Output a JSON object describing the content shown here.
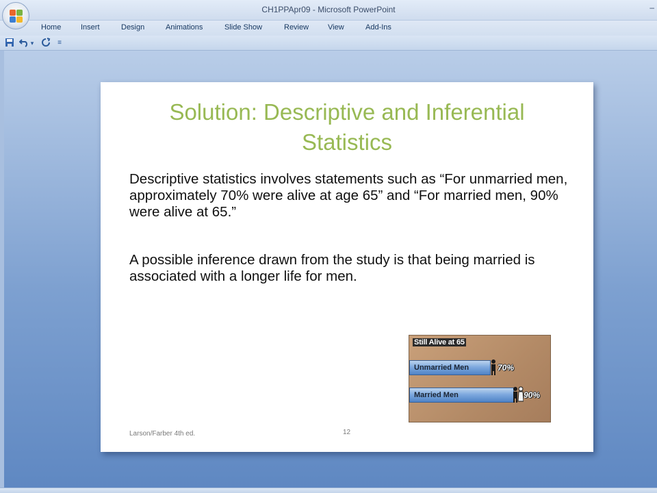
{
  "window": {
    "title": "CH1PPApr09 - Microsoft PowerPoint",
    "controls": "–"
  },
  "ribbon": {
    "tabs": [
      {
        "label": "Home"
      },
      {
        "label": "Insert"
      },
      {
        "label": "Design"
      },
      {
        "label": "Animations"
      },
      {
        "label": "Slide Show"
      },
      {
        "label": "Review"
      },
      {
        "label": "View"
      },
      {
        "label": "Add-Ins"
      }
    ]
  },
  "quick_access": {
    "icons": [
      "save-icon",
      "undo-icon",
      "dropdown-arrow-icon",
      "redo-icon",
      "customize-icon"
    ],
    "dropdown_glyph": "▾",
    "customize_glyph": "≡"
  },
  "slide": {
    "title": "Solution: Descriptive and Inferential Statistics",
    "paragraph1": "Descriptive statistics involves statements such as “For unmarried men, approximately 70% were alive at age 65” and “For married men, 90% were alive at 65.”",
    "paragraph2": "A possible inference drawn from the study is that being married is associated with a longer life for men.",
    "footer": "Larson/Farber 4th ed.",
    "slide_number": "12"
  },
  "chart_data": {
    "type": "bar",
    "title": "Still Alive at 65",
    "categories": [
      "Unmarried Men",
      "Married Men"
    ],
    "values": [
      70,
      90
    ],
    "value_labels": [
      "70%",
      "90%"
    ],
    "xlim": [
      0,
      100
    ],
    "orientation": "horizontal",
    "colors": {
      "bar": "#6b9bd6",
      "background": "#b8906c"
    }
  },
  "colors": {
    "title_green": "#98b954",
    "workspace_blue": "#5f88c2"
  }
}
